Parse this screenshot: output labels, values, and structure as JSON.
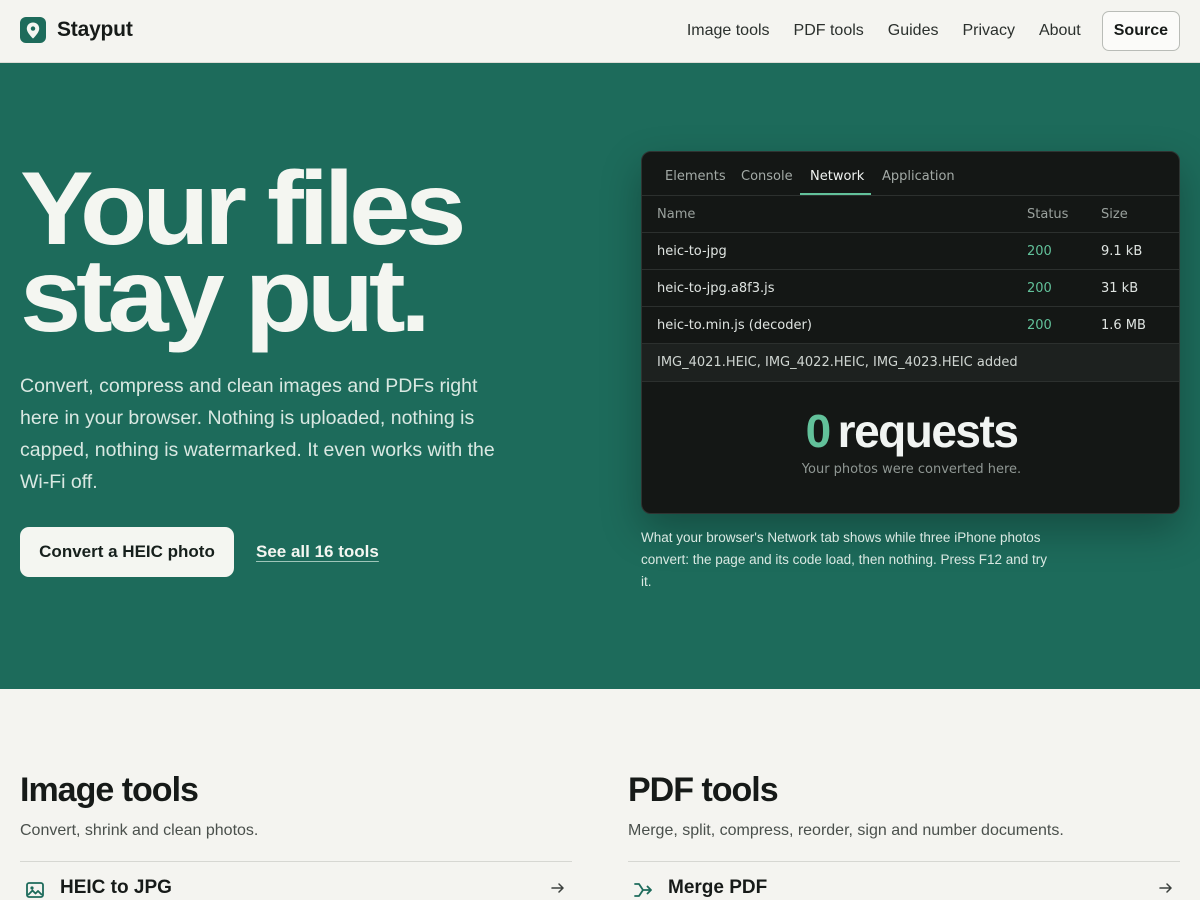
{
  "header": {
    "brand": "Stayput",
    "nav": [
      "Image tools",
      "PDF tools",
      "Guides",
      "Privacy",
      "About"
    ],
    "source_label": "Source"
  },
  "hero": {
    "title_line1": "Your files",
    "title_line2": "stay put.",
    "description": "Convert, compress and clean images and PDFs right here in your browser. Nothing is uploaded, nothing is capped, nothing is watermarked. It even works with the Wi-Fi off.",
    "cta_label": "Convert a HEIC photo",
    "see_all_label": "See all 16 tools"
  },
  "devtools": {
    "tabs": [
      "Elements",
      "Console",
      "Network",
      "Application"
    ],
    "active_tab": "Network",
    "columns": [
      "Name",
      "Status",
      "Size"
    ],
    "rows": [
      {
        "name": "heic-to-jpg",
        "status": "200",
        "size": "9.1 kB"
      },
      {
        "name": "heic-to-jpg.a8f3.js",
        "status": "200",
        "size": "31 kB"
      },
      {
        "name": "heic-to.min.js (decoder)",
        "status": "200",
        "size": "1.6 MB"
      }
    ],
    "log": "IMG_4021.HEIC, IMG_4022.HEIC, IMG_4023.HEIC added",
    "count": "0",
    "count_label": "requests",
    "sub": "Your photos were converted here."
  },
  "caption": "What your browser's Network tab shows while three iPhone photos convert: the page and its code load, then nothing. Press F12 and try it.",
  "sections": {
    "image": {
      "title": "Image tools",
      "subtitle": "Convert, shrink and clean photos.",
      "first_tool": "HEIC to JPG",
      "icon": "image-icon"
    },
    "pdf": {
      "title": "PDF tools",
      "subtitle": "Merge, split, compress, reorder, sign and number documents.",
      "first_tool": "Merge PDF",
      "icon": "merge-icon"
    }
  },
  "colors": {
    "brand": "#1d6b5b",
    "accent": "#62c19a",
    "background": "#f4f4f0",
    "ink": "#161a18"
  }
}
